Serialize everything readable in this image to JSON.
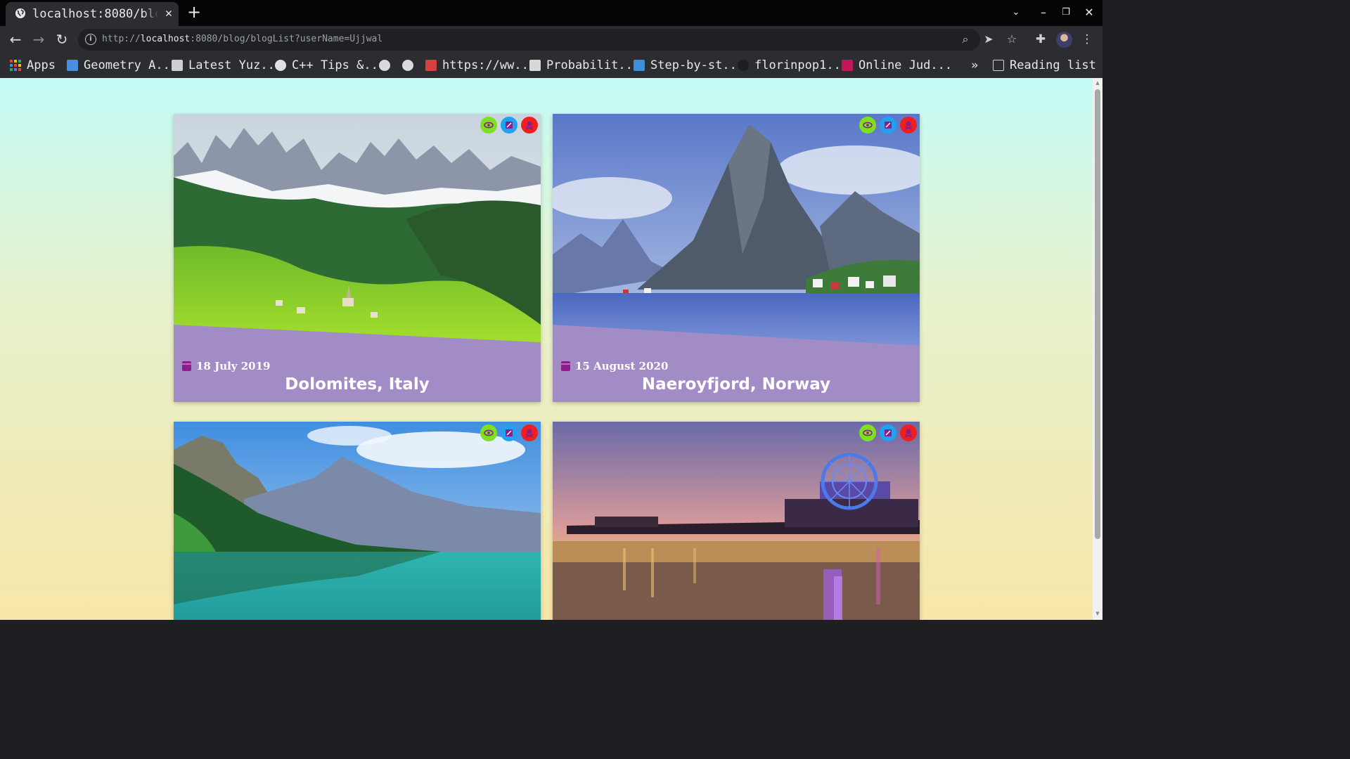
{
  "browser": {
    "tab_title": "localhost:8080/blog/blogList?userName=Ujjwal",
    "tab_close": "✕",
    "new_tab": "+",
    "url_scheme": "http://",
    "url_host": "localhost",
    "url_rest": ":8080/blog/blogList?userName=Ujjwal",
    "bookmarks": [
      {
        "label": "Apps",
        "icon": "apps-grid-icon"
      },
      {
        "label": "Geometry A...",
        "icon": "geometry-bookmark-icon",
        "color": "#4a8ee0"
      },
      {
        "label": "Latest Yuz...",
        "icon": "yuzu-bookmark-icon",
        "color": "#cfcfcf"
      },
      {
        "label": "C++ Tips &...",
        "icon": "cpp-bookmark-icon",
        "color": "#e0e0e0"
      },
      {
        "label": "",
        "icon": "globe-icon"
      },
      {
        "label": "",
        "icon": "globe-icon"
      },
      {
        "label": "https://ww...",
        "icon": "site-bookmark-icon",
        "color": "#d84040"
      },
      {
        "label": "Probabilit...",
        "icon": "probability-bookmark-icon",
        "color": "#d8d8d8"
      },
      {
        "label": "Step-by-st...",
        "icon": "step-bookmark-icon",
        "color": "#3f8fd8"
      },
      {
        "label": "florinpop1...",
        "icon": "github-icon",
        "color": "#1e1e1e"
      },
      {
        "label": "Online Jud...",
        "icon": "uva-bookmark-icon",
        "color": "#c2185b"
      }
    ],
    "overflow": "»",
    "reading_list": "Reading list"
  },
  "blog": {
    "cards": [
      {
        "date": "18 July 2019",
        "title": "Dolomites, Italy",
        "scene": "mountains-meadow"
      },
      {
        "date": "15 August 2020",
        "title": "Naeroyfjord, Norway",
        "scene": "fjord"
      },
      {
        "date": "",
        "title": "",
        "scene": "lake"
      },
      {
        "date": "",
        "title": "",
        "scene": "pier-sunset"
      }
    ]
  },
  "colors": {
    "card_bg": "#a28cc6",
    "view": "#7ee020",
    "edit": "#1fa3f0",
    "delete": "#f01f1f",
    "calendar": "#8b1e8b"
  }
}
